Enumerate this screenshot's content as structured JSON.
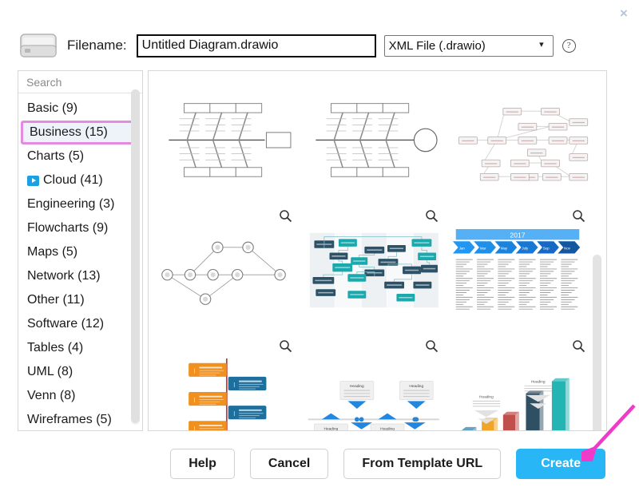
{
  "dialog": {
    "close_label": "×",
    "close_icon": "close-icon",
    "drive_icon": "hard-drive-icon"
  },
  "header": {
    "filename_label": "Filename:",
    "filename_value": "Untitled Diagram.drawio",
    "filename_placeholder": "Untitled Diagram.drawio",
    "filetype_value": "XML File (.drawio)",
    "filetype_options": [
      "XML File (.drawio)"
    ],
    "chevron_icon": "chevron-down-icon",
    "help_icon": "help-icon",
    "help_label": "?"
  },
  "sidebar": {
    "search_placeholder": "Search",
    "search_value": "",
    "search_icon": "search-icon",
    "items": [
      {
        "label": "Basic (9)",
        "name": "basic",
        "selected": false,
        "icon": null
      },
      {
        "label": "Business (15)",
        "name": "business",
        "selected": true,
        "icon": null
      },
      {
        "label": "Charts (5)",
        "name": "charts",
        "selected": false,
        "icon": null
      },
      {
        "label": "Cloud (41)",
        "name": "cloud",
        "selected": false,
        "icon": "cloud-play-icon"
      },
      {
        "label": "Engineering (3)",
        "name": "engineering",
        "selected": false,
        "icon": null
      },
      {
        "label": "Flowcharts (9)",
        "name": "flowcharts",
        "selected": false,
        "icon": null
      },
      {
        "label": "Maps (5)",
        "name": "maps",
        "selected": false,
        "icon": null
      },
      {
        "label": "Network (13)",
        "name": "network",
        "selected": false,
        "icon": null
      },
      {
        "label": "Other (11)",
        "name": "other",
        "selected": false,
        "icon": null
      },
      {
        "label": "Software (12)",
        "name": "software",
        "selected": false,
        "icon": null
      },
      {
        "label": "Tables (4)",
        "name": "tables",
        "selected": false,
        "icon": null
      },
      {
        "label": "UML (8)",
        "name": "uml",
        "selected": false,
        "icon": null
      },
      {
        "label": "Venn (8)",
        "name": "venn",
        "selected": false,
        "icon": null
      },
      {
        "label": "Wireframes (5)",
        "name": "wireframes",
        "selected": false,
        "icon": null
      }
    ],
    "selected_highlight_color": "#e48ae0"
  },
  "templates": {
    "zoom_icon": "magnifier-icon",
    "items": [
      {
        "name": "fishbone-diagram-1",
        "kind": "fishbone",
        "has_zoom": false
      },
      {
        "name": "fishbone-diagram-2",
        "kind": "fishbone-circle",
        "has_zoom": false
      },
      {
        "name": "tree-network-diagram",
        "kind": "tree",
        "has_zoom": false
      },
      {
        "name": "pert-network-diagram",
        "kind": "pert",
        "has_zoom": true
      },
      {
        "name": "swimlane-flowchart",
        "kind": "swimlane",
        "has_zoom": true
      },
      {
        "name": "timeline-2017",
        "kind": "timeline-year",
        "has_zoom": true
      },
      {
        "name": "vertical-timeline-infographic",
        "kind": "vertical-timeline",
        "has_zoom": true
      },
      {
        "name": "horizontal-timeline-infographic",
        "kind": "horizontal-timeline",
        "has_zoom": true
      },
      {
        "name": "bar-chart-infographic",
        "kind": "bar-infographic",
        "has_zoom": true
      }
    ],
    "timeline_year": "2017",
    "timeline_months": [
      "Jan",
      "Mar",
      "May",
      "July",
      "Sep",
      "Nov"
    ],
    "heading_label": "Heading"
  },
  "footer": {
    "help_label": "Help",
    "cancel_label": "Cancel",
    "template_url_label": "From Template URL",
    "create_label": "Create",
    "create_color": "#29b6f6"
  },
  "annotation": {
    "arrow_color": "#ef3bc8",
    "arrow_icon": "arrow-pointer-icon"
  }
}
